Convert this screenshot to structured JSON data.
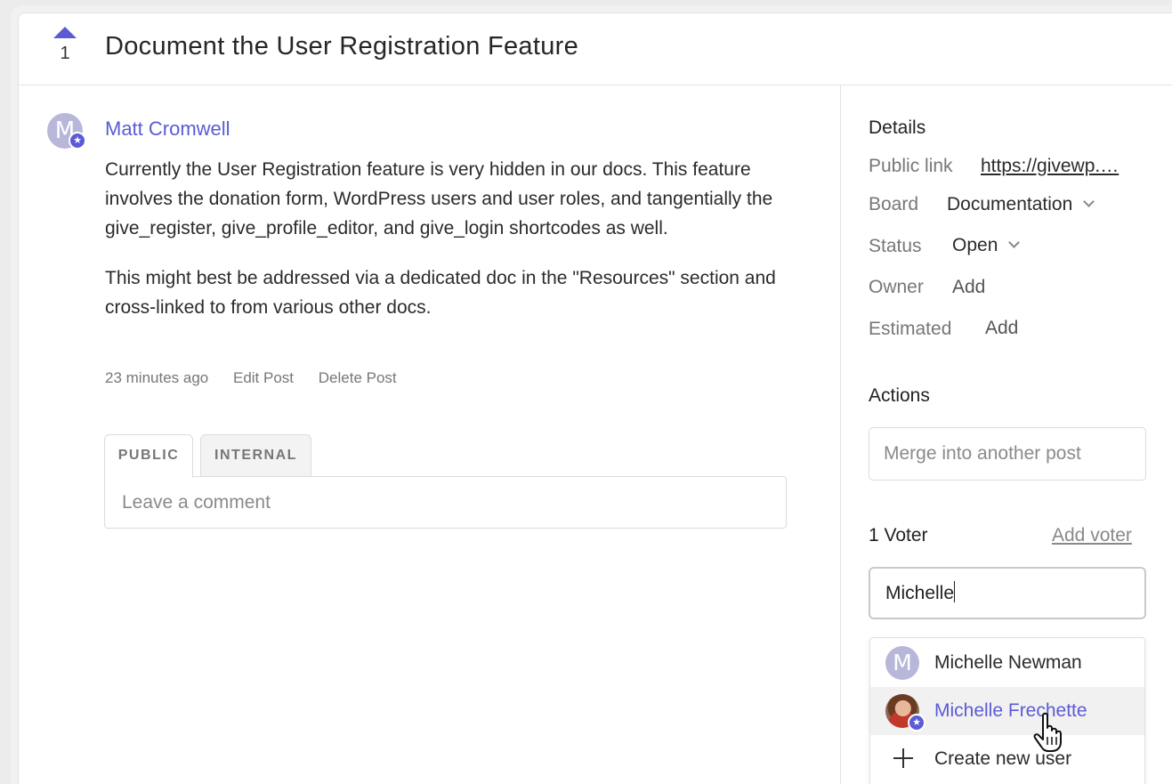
{
  "post": {
    "vote_count": "1",
    "title": "Document the User Registration Feature",
    "author": {
      "initial": "M",
      "name": "Matt Cromwell"
    },
    "body": [
      "Currently the User Registration feature is very hidden in our docs. This feature involves the donation form, WordPress users and user roles, and tangentially the give_register, give_profile_editor, and give_login shortcodes as well.",
      "This might best be addressed via a dedicated doc in the \"Resources\" section and cross-linked to from various other docs."
    ],
    "meta": {
      "time": "23 minutes ago",
      "edit": "Edit Post",
      "delete": "Delete Post"
    }
  },
  "comment": {
    "tabs": [
      "PUBLIC",
      "INTERNAL"
    ],
    "placeholder": "Leave a comment"
  },
  "details": {
    "title": "Details",
    "public_link_label": "Public link",
    "public_link_value": "https://givewp.…",
    "board_label": "Board",
    "board_value": "Documentation",
    "status_label": "Status",
    "status_value": "Open",
    "owner_label": "Owner",
    "owner_value": "Add",
    "estimated_label": "Estimated",
    "estimated_value": "Add"
  },
  "actions": {
    "title": "Actions",
    "merge_placeholder": "Merge into another post"
  },
  "voters": {
    "title": "1 Voter",
    "add_voter": "Add voter",
    "input_value": "Michelle",
    "results": [
      {
        "initial": "M",
        "name": "Michelle Newman"
      },
      {
        "name": "Michelle Frechette"
      }
    ],
    "create_new": "Create new user"
  },
  "colors": {
    "accent": "#5b5bd6",
    "avatar_bg": "#b7b7da"
  }
}
